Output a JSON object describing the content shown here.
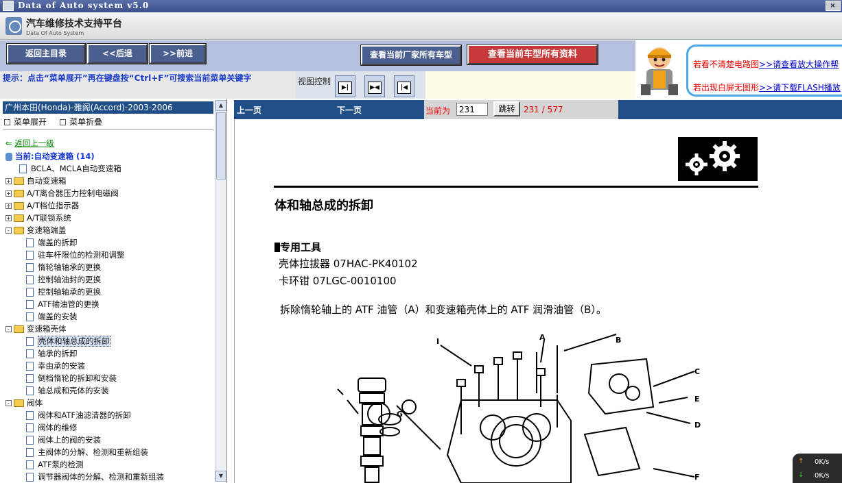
{
  "window": {
    "title": "Data of Auto system v5.0",
    "min": "_",
    "max": "□",
    "close": "×"
  },
  "header": {
    "name": "汽车维修技术支持平台",
    "sub": "Data Of Auto System"
  },
  "toolbar": {
    "home": "返回主目录",
    "back": "<<后退",
    "forward": ">>前进",
    "all_models": "查看当前厂家所有车型",
    "all_docs": "查看当前车型所有资料"
  },
  "hint": "提示：点击“菜单展开”再在键盘按“Ctrl+F”可搜索当前菜单关键字",
  "view_control": {
    "label": "视图控制"
  },
  "ad": {
    "line1": "若看不清楚电路图",
    "link1": ">>请查看放大操作帮",
    "line2": "若出现白屏无图形",
    "link2": ">>请下载FLASH播放"
  },
  "tree": {
    "selected_vehicle": "广州本田(Honda)-雅阁(Accord)-2003-2006",
    "expand": "菜单展开",
    "collapse": "菜单折叠",
    "back_up": "返回上一级",
    "current": "当前:自动变速箱 (14)",
    "items": [
      {
        "type": "doc",
        "level": 1,
        "label": "BCLA、MCLA自动变速箱"
      },
      {
        "type": "folder",
        "level": 1,
        "label": "自动变速箱",
        "exp": "+"
      },
      {
        "type": "folder",
        "level": 1,
        "label": "A/T离合器压力控制电磁阀",
        "exp": "+"
      },
      {
        "type": "folder",
        "level": 1,
        "label": "A/T档位指示器",
        "exp": "+"
      },
      {
        "type": "folder",
        "level": 1,
        "label": "A/T联锁系统",
        "exp": "+"
      },
      {
        "type": "folder",
        "level": 1,
        "label": "变速箱端盖",
        "exp": "-"
      },
      {
        "type": "doc",
        "level": 2,
        "label": "端盖的拆卸"
      },
      {
        "type": "doc",
        "level": 2,
        "label": "驻车杆限位的检测和调整"
      },
      {
        "type": "doc",
        "level": 2,
        "label": "惰轮轴轴承的更换"
      },
      {
        "type": "doc",
        "level": 2,
        "label": "控制轴油封的更换"
      },
      {
        "type": "doc",
        "level": 2,
        "label": "控制轴轴承的更换"
      },
      {
        "type": "doc",
        "level": 2,
        "label": "ATF输油管的更换"
      },
      {
        "type": "doc",
        "level": 2,
        "label": "端盖的安装"
      },
      {
        "type": "folder",
        "level": 1,
        "label": "变速箱壳体",
        "exp": "-"
      },
      {
        "type": "doc",
        "level": 2,
        "label": "壳体和轴总成的拆卸",
        "selected": true
      },
      {
        "type": "doc",
        "level": 2,
        "label": "轴承的拆卸"
      },
      {
        "type": "doc",
        "level": 2,
        "label": "幸由承的安装"
      },
      {
        "type": "doc",
        "level": 2,
        "label": "倒档惰轮的拆卸和安装"
      },
      {
        "type": "doc",
        "level": 2,
        "label": "轴总成和壳体的安装"
      },
      {
        "type": "folder",
        "level": 1,
        "label": "阀体",
        "exp": "-"
      },
      {
        "type": "doc",
        "level": 2,
        "label": "阀体和ATF油滤清器的拆卸"
      },
      {
        "type": "doc",
        "level": 2,
        "label": "阀体的维修"
      },
      {
        "type": "doc",
        "level": 2,
        "label": "阀体上的阀的安装"
      },
      {
        "type": "doc",
        "level": 2,
        "label": "主阀体的分解、检测和重新组装"
      },
      {
        "type": "doc",
        "level": 2,
        "label": "ATF泵的检测"
      },
      {
        "type": "doc",
        "level": 2,
        "label": "调节器阀体的分解、检测和重新组装"
      }
    ]
  },
  "pager": {
    "prev": "上一页",
    "next": "下一页",
    "current_label": "当前为",
    "page": "231",
    "go": "跳转",
    "total": "231 / 577"
  },
  "document": {
    "title": "体和轴总成的拆卸",
    "tools_heading": "专用工具",
    "tool1": "壳体拉拔器 07HAC-PK40102",
    "tool2": "卡环钳 07LGC-0010100",
    "step1": "拆除惰轮轴上的 ATF 油管（A）和变速箱壳体上的 ATF 润滑油管（B）。",
    "callouts": [
      "I",
      "A",
      "B",
      "C",
      "E",
      "D",
      "G",
      "F"
    ]
  },
  "speed": {
    "up": "0K/s",
    "down": "0K/s"
  }
}
